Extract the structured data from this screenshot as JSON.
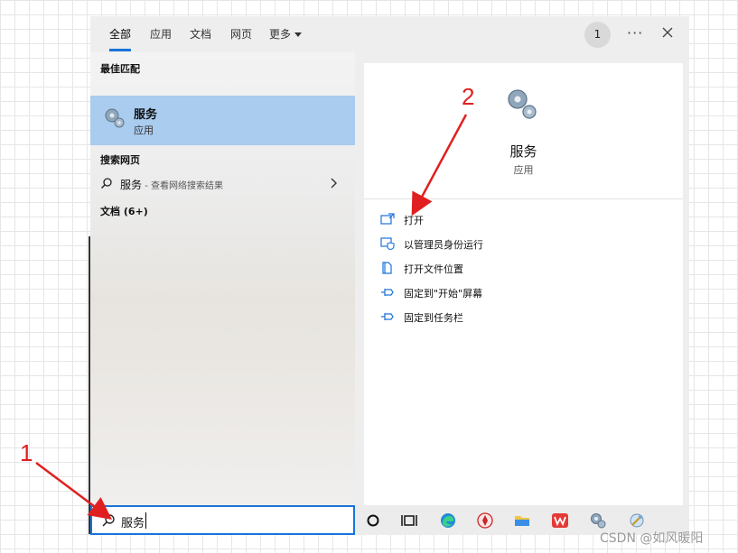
{
  "tabs": [
    {
      "label": "全部",
      "active": true
    },
    {
      "label": "应用"
    },
    {
      "label": "文档"
    },
    {
      "label": "网页"
    },
    {
      "label": "更多"
    }
  ],
  "header": {
    "badge": "1",
    "more": "···"
  },
  "left": {
    "best_match_header": "最佳匹配",
    "best_match": {
      "name": "服务",
      "type": "应用"
    },
    "web_header": "搜索网页",
    "web_item": {
      "query": "服务",
      "hint": " - 查看网络搜索结果"
    },
    "docs_header": "文档 (6+)"
  },
  "right": {
    "app_name": "服务",
    "app_type": "应用",
    "actions": [
      {
        "label": "打开",
        "icon": "open-window-icon"
      },
      {
        "label": "以管理员身份运行",
        "icon": "admin-shield-icon"
      },
      {
        "label": "打开文件位置",
        "icon": "file-location-icon"
      },
      {
        "label": "固定到\"开始\"屏幕",
        "icon": "pin-icon"
      },
      {
        "label": "固定到任务栏",
        "icon": "pin-icon"
      }
    ]
  },
  "search": {
    "value": "服务"
  },
  "taskbar_icons": [
    "cortana-circle-icon",
    "task-view-icon",
    "edge-icon",
    "red-app-icon",
    "file-explorer-icon",
    "wps-icon",
    "services-gear-icon",
    "tool-icon"
  ],
  "annotations": {
    "label1": "1",
    "label2": "2",
    "color": "#e02020"
  },
  "watermark": "CSDN @如风暖阳",
  "colors": {
    "accent": "#1a73d9",
    "selection": "#a9ccef"
  }
}
